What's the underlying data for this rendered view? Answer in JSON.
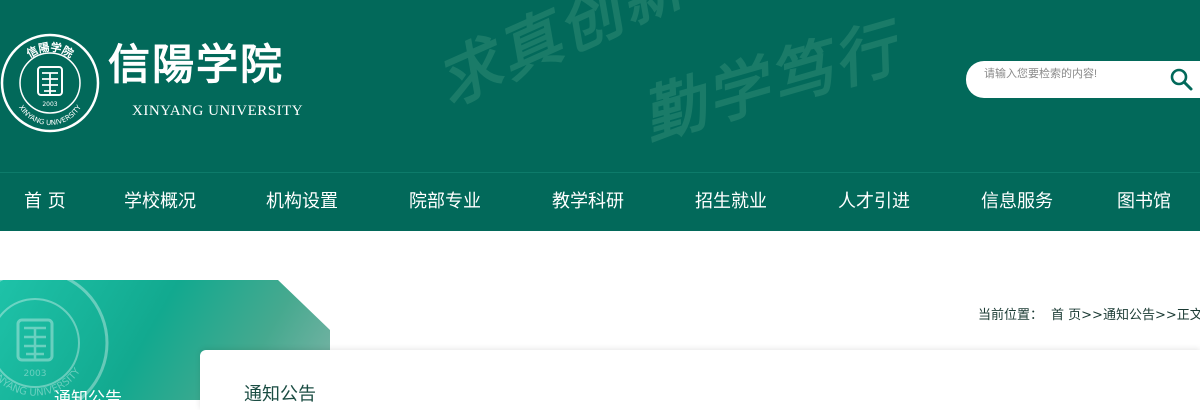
{
  "header": {
    "brand_cn": "信陽学院",
    "brand_en": "XINYANG UNIVERSITY",
    "seal_text_top": "信陽学院",
    "seal_text_bottom": "XINYANG UNIVERSITY",
    "seal_year": "2003",
    "motto_1": "求真创新",
    "motto_2": "勤学笃行",
    "search": {
      "placeholder": "请输入您要检索的内容!",
      "button_icon": "search-icon"
    }
  },
  "nav": {
    "items": [
      {
        "label": "首 页"
      },
      {
        "label": "学校概况"
      },
      {
        "label": "机构设置"
      },
      {
        "label": "院部专业"
      },
      {
        "label": "教学科研"
      },
      {
        "label": "招生就业"
      },
      {
        "label": "人才引进"
      },
      {
        "label": "信息服务"
      },
      {
        "label": "图书馆"
      }
    ]
  },
  "sidebar": {
    "title": "通知公告",
    "seal_year": "2003",
    "seal_text": "XINYANG UNIVERSITY"
  },
  "breadcrumb": {
    "label": "当前位置：",
    "home": "首 页",
    "sep": ">>",
    "section": "通知公告",
    "current": "正文"
  },
  "content": {
    "title": "通知公告"
  },
  "colors": {
    "primary": "#02695a",
    "accent": "#1ec2a8",
    "text_dark": "#1a3a33"
  }
}
